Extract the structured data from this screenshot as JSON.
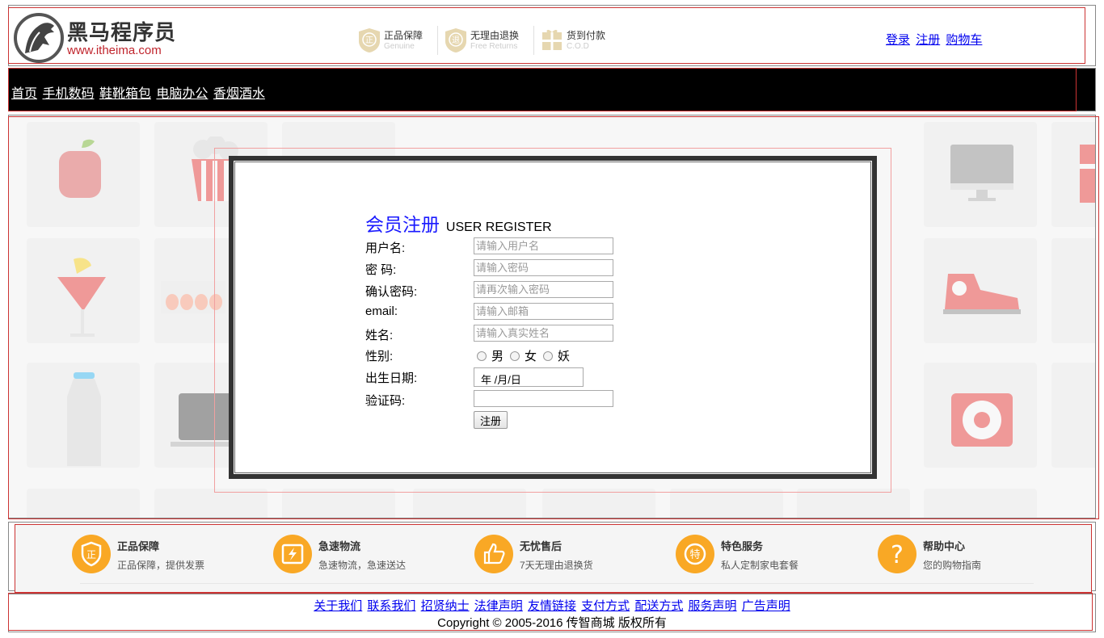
{
  "header": {
    "brand_name": "黑马程序员",
    "brand_url": "www.itheima.com",
    "guarantees": [
      {
        "badge": "正",
        "cn": "正品保障",
        "en": "Genuine"
      },
      {
        "badge": "退",
        "cn": "无理由退换",
        "en": "Free Returns"
      },
      {
        "badge": "款",
        "cn": "货到付款",
        "en": "C.O.D"
      }
    ],
    "user_links": {
      "login": "登录",
      "register": "注册",
      "cart": "购物车"
    }
  },
  "nav": {
    "items": [
      "首页",
      "手机数码",
      "鞋靴箱包",
      "电脑办公",
      "香烟酒水"
    ]
  },
  "register": {
    "title_cn": "会员注册",
    "title_en": "USER REGISTER",
    "fields": {
      "username": {
        "label": "用户名:",
        "placeholder": "请输入用户名"
      },
      "password": {
        "label": "密 码:",
        "placeholder": "请输入密码"
      },
      "confirm": {
        "label": "确认密码:",
        "placeholder": "请再次输入密码"
      },
      "email": {
        "label": "email:",
        "placeholder": "请输入邮箱"
      },
      "name": {
        "label": "姓名:",
        "placeholder": "请输入真实姓名"
      },
      "gender": {
        "label": "性别:",
        "options": [
          "男",
          "女",
          "妖"
        ]
      },
      "birthday": {
        "label": "出生日期:",
        "value": "年 /月/日"
      },
      "captcha": {
        "label": "验证码:",
        "placeholder": ""
      }
    },
    "submit_label": "注册"
  },
  "services": [
    {
      "icon": "shield-icon",
      "glyph": "正",
      "title": "正品保障",
      "sub": "正品保障，提供发票"
    },
    {
      "icon": "lightning-icon",
      "glyph": "⚡",
      "title": "急速物流",
      "sub": "急速物流，急速送达"
    },
    {
      "icon": "thumbs-up-icon",
      "glyph": "👍",
      "title": "无忧售后",
      "sub": "7天无理由退换货"
    },
    {
      "icon": "special-icon",
      "glyph": "特",
      "title": "特色服务",
      "sub": "私人定制家电套餐"
    },
    {
      "icon": "help-icon",
      "glyph": "?",
      "title": "帮助中心",
      "sub": "您的购物指南"
    }
  ],
  "footer": {
    "links": [
      "关于我们",
      "联系我们",
      "招贤纳士",
      "法律声明",
      "友情链接",
      "支付方式",
      "配送方式",
      "服务声明",
      "广告声明"
    ],
    "copyright": "Copyright © 2005-2016 传智商城 版权所有"
  },
  "colors": {
    "nav_bg": "#000000",
    "title_blue": "#1a1aff",
    "service_orange": "#f9a825",
    "brand_red": "#c0242c"
  }
}
